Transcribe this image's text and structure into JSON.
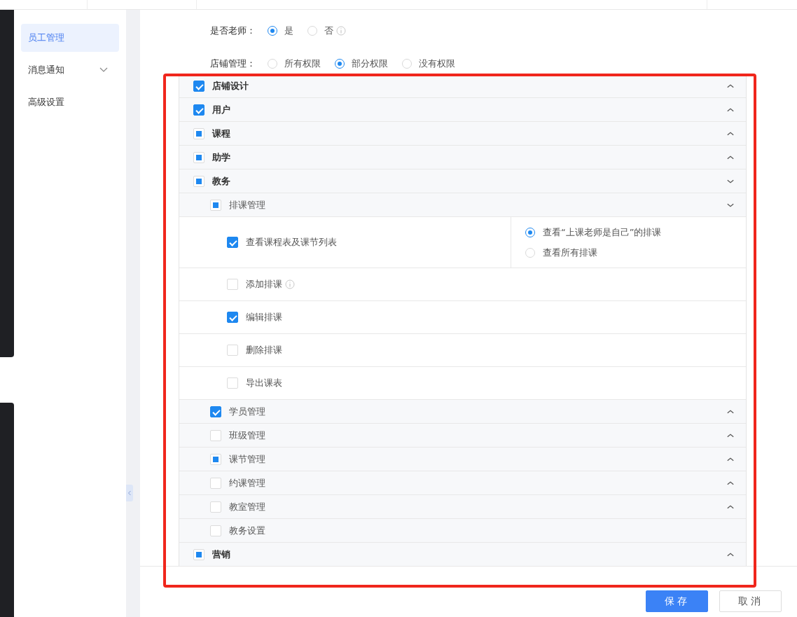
{
  "sidebar": {
    "items": [
      {
        "label": "员工管理",
        "selected": true,
        "expandable": false
      },
      {
        "label": "消息通知",
        "selected": false,
        "expandable": true
      },
      {
        "label": "高级设置",
        "selected": false,
        "expandable": false
      }
    ]
  },
  "form": {
    "fields": [
      {
        "label": "是否老师：",
        "options": [
          {
            "label": "是",
            "selected": true
          },
          {
            "label": "否",
            "selected": false,
            "info": true
          }
        ]
      },
      {
        "label": "店铺管理：",
        "options": [
          {
            "label": "所有权限",
            "selected": false
          },
          {
            "label": "部分权限",
            "selected": true
          },
          {
            "label": "没有权限",
            "selected": false
          }
        ]
      }
    ]
  },
  "permissions": [
    {
      "label": "店铺设计",
      "checked": true,
      "indeterminate": false,
      "expanded": false,
      "has_children": true
    },
    {
      "label": "用户",
      "checked": true,
      "indeterminate": false,
      "expanded": false,
      "has_children": true
    },
    {
      "label": "课程",
      "checked": false,
      "indeterminate": true,
      "expanded": false,
      "has_children": true
    },
    {
      "label": "助学",
      "checked": false,
      "indeterminate": true,
      "expanded": false,
      "has_children": true
    },
    {
      "label": "教务",
      "checked": false,
      "indeterminate": true,
      "expanded": true,
      "has_children": true,
      "children": [
        {
          "label": "排课管理",
          "checked": false,
          "indeterminate": true,
          "expanded": true,
          "has_children": true,
          "actions": [
            {
              "label": "查看课程表及课节列表",
              "checked": true,
              "options": [
                {
                  "label": "查看“上课老师是自己”的排课",
                  "selected": true
                },
                {
                  "label": "查看所有排课",
                  "selected": false
                }
              ]
            },
            {
              "label": "添加排课",
              "checked": false,
              "info": true
            },
            {
              "label": "编辑排课",
              "checked": true
            },
            {
              "label": "删除排课",
              "checked": false
            },
            {
              "label": "导出课表",
              "checked": false
            }
          ]
        },
        {
          "label": "学员管理",
          "checked": true,
          "indeterminate": false,
          "expanded": false,
          "has_children": true
        },
        {
          "label": "班级管理",
          "checked": false,
          "indeterminate": false,
          "expanded": false,
          "has_children": true
        },
        {
          "label": "课节管理",
          "checked": false,
          "indeterminate": true,
          "expanded": false,
          "has_children": true
        },
        {
          "label": "约课管理",
          "checked": false,
          "indeterminate": false,
          "expanded": false,
          "has_children": true
        },
        {
          "label": "教室管理",
          "checked": false,
          "indeterminate": false,
          "expanded": false,
          "has_children": true
        },
        {
          "label": "教务设置",
          "checked": false,
          "indeterminate": false,
          "has_children": false
        }
      ]
    },
    {
      "label": "营销",
      "checked": false,
      "indeterminate": true,
      "expanded": false,
      "has_children": true
    }
  ],
  "buttons": [
    {
      "label": "保存",
      "kind": "primary"
    },
    {
      "label": "取消",
      "kind": "default"
    }
  ]
}
